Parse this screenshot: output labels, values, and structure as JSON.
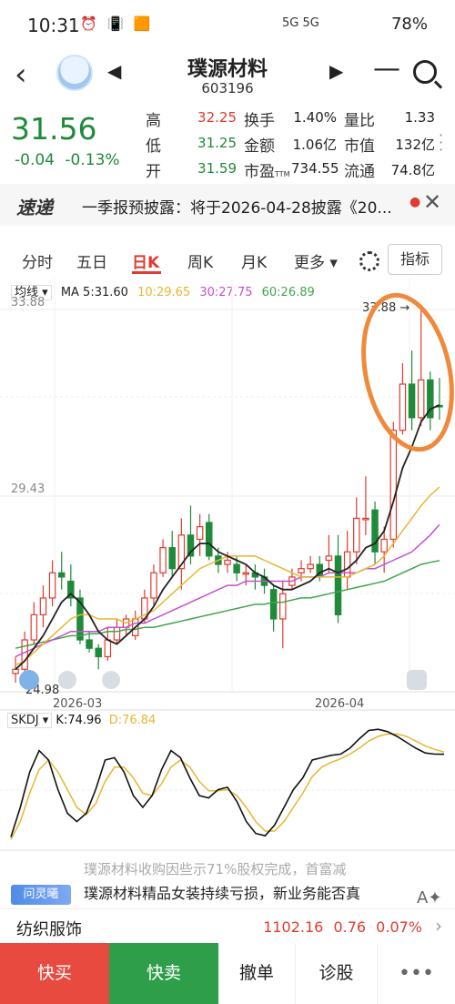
{
  "status_bar": {
    "time": "10:31",
    "icons": "⏰ 📳 🟧",
    "network": "5G 5G",
    "battery": "78%"
  },
  "header": {
    "name": "璞源材料",
    "code": "603196"
  },
  "quote": {
    "price": "31.56",
    "change": "-0.04",
    "change_pct": "-0.13%",
    "high_label": "高",
    "high": "32.25",
    "low_label": "低",
    "low": "31.25",
    "open_label": "开",
    "open": "31.59",
    "turnover_label": "换手",
    "turnover": "1.40%",
    "amount_label": "金额",
    "amount": "1.06亿",
    "pe_label": "市盈",
    "pe_ttm": "TTM",
    "pe": "734.55",
    "vol_ratio_label": "量比",
    "vol_ratio": "1.33",
    "mkt_cap_label": "市值",
    "mkt_cap": "132亿",
    "float_label": "流通",
    "float": "74.8亿"
  },
  "news": {
    "badge": "速递",
    "text": "一季报预披露：将于2026-04-28披露《20..."
  },
  "tabs": [
    "分时",
    "五日",
    "日K",
    "周K",
    "月K",
    "更多 ▾"
  ],
  "indicator_button": "指标",
  "ma_legend": {
    "type": "均线 ▾",
    "ma5": "MA 5:31.60",
    "ma10": "10:29.65",
    "ma20": "30:27.75",
    "ma60": "60:26.89",
    "colors": {
      "ma5": "#222222",
      "ma10": "#e8b632",
      "ma20": "#c64fcf",
      "ma60": "#3fa64a"
    }
  },
  "chart_data": [
    {
      "type": "candlestick",
      "y_labels": [
        "33.88",
        "29.43"
      ],
      "x_labels": [
        "2026-03",
        "2026-04"
      ],
      "annotations": {
        "max_label": "33.88",
        "min_label": "24.98"
      },
      "candles": [
        {
          "o": 25.2,
          "c": 25.3,
          "h": 25.6,
          "l": 24.98
        },
        {
          "o": 25.3,
          "c": 26.0,
          "h": 26.2,
          "l": 25.2
        },
        {
          "o": 26.0,
          "c": 26.6,
          "h": 26.9,
          "l": 25.9
        },
        {
          "o": 26.6,
          "c": 27.0,
          "h": 27.3,
          "l": 26.3
        },
        {
          "o": 27.0,
          "c": 27.6,
          "h": 27.9,
          "l": 26.8
        },
        {
          "o": 27.6,
          "c": 27.5,
          "h": 28.1,
          "l": 27.2
        },
        {
          "o": 27.4,
          "c": 27.0,
          "h": 27.8,
          "l": 26.8
        },
        {
          "o": 27.0,
          "c": 26.0,
          "h": 27.2,
          "l": 25.9
        },
        {
          "o": 26.0,
          "c": 25.8,
          "h": 26.2,
          "l": 25.7
        },
        {
          "o": 25.8,
          "c": 25.6,
          "h": 25.9,
          "l": 25.3
        },
        {
          "o": 25.6,
          "c": 26.0,
          "h": 26.3,
          "l": 25.5
        },
        {
          "o": 26.0,
          "c": 26.3,
          "h": 26.5,
          "l": 25.9
        },
        {
          "o": 26.3,
          "c": 26.5,
          "h": 26.6,
          "l": 26.1
        },
        {
          "o": 26.1,
          "c": 26.5,
          "h": 26.7,
          "l": 26.0
        },
        {
          "o": 26.5,
          "c": 27.0,
          "h": 27.2,
          "l": 26.4
        },
        {
          "o": 27.0,
          "c": 27.6,
          "h": 27.8,
          "l": 26.8
        },
        {
          "o": 27.6,
          "c": 28.2,
          "h": 28.4,
          "l": 27.5
        },
        {
          "o": 28.2,
          "c": 27.7,
          "h": 28.6,
          "l": 27.5
        },
        {
          "o": 27.7,
          "c": 28.5,
          "h": 28.9,
          "l": 27.2
        },
        {
          "o": 28.5,
          "c": 28.0,
          "h": 29.2,
          "l": 27.8
        },
        {
          "o": 28.4,
          "c": 28.7,
          "h": 29.0,
          "l": 28.0
        },
        {
          "o": 28.8,
          "c": 28.0,
          "h": 29.0,
          "l": 27.9
        },
        {
          "o": 28.0,
          "c": 27.8,
          "h": 28.2,
          "l": 27.6
        },
        {
          "o": 27.8,
          "c": 27.9,
          "h": 28.1,
          "l": 27.6
        },
        {
          "o": 27.8,
          "c": 27.6,
          "h": 28.0,
          "l": 27.4
        },
        {
          "o": 27.6,
          "c": 27.6,
          "h": 27.8,
          "l": 27.3
        },
        {
          "o": 27.6,
          "c": 27.5,
          "h": 27.8,
          "l": 27.2
        },
        {
          "o": 27.5,
          "c": 27.3,
          "h": 27.7,
          "l": 27.1
        },
        {
          "o": 27.2,
          "c": 26.5,
          "h": 27.3,
          "l": 26.2
        },
        {
          "o": 26.5,
          "c": 27.1,
          "h": 27.4,
          "l": 25.8
        },
        {
          "o": 27.3,
          "c": 27.5,
          "h": 27.7,
          "l": 27.2
        },
        {
          "o": 27.6,
          "c": 27.7,
          "h": 27.9,
          "l": 27.4
        },
        {
          "o": 27.7,
          "c": 27.8,
          "h": 28.0,
          "l": 27.6
        },
        {
          "o": 27.8,
          "c": 27.5,
          "h": 28.0,
          "l": 27.4
        },
        {
          "o": 27.9,
          "c": 28.0,
          "h": 28.5,
          "l": 27.6
        },
        {
          "o": 28.0,
          "c": 26.6,
          "h": 28.5,
          "l": 26.4
        },
        {
          "o": 27.5,
          "c": 28.1,
          "h": 28.6,
          "l": 27.2
        },
        {
          "o": 28.1,
          "c": 28.9,
          "h": 29.4,
          "l": 27.8
        },
        {
          "o": 28.9,
          "c": 28.9,
          "h": 29.9,
          "l": 28.5
        },
        {
          "o": 29.1,
          "c": 28.1,
          "h": 29.3,
          "l": 27.8
        },
        {
          "o": 28.1,
          "c": 28.4,
          "h": 28.7,
          "l": 27.6
        },
        {
          "o": 28.4,
          "c": 31.0,
          "h": 31.2,
          "l": 28.2
        },
        {
          "o": 31.0,
          "c": 32.1,
          "h": 32.6,
          "l": 30.9
        },
        {
          "o": 32.1,
          "c": 31.3,
          "h": 32.9,
          "l": 31.0
        },
        {
          "o": 31.3,
          "c": 32.2,
          "h": 33.88,
          "l": 31.1
        },
        {
          "o": 32.2,
          "c": 31.3,
          "h": 32.4,
          "l": 31.0
        },
        {
          "o": 31.59,
          "c": 31.56,
          "h": 32.25,
          "l": 31.25
        }
      ],
      "ma5": [
        25.3,
        25.5,
        25.8,
        26.1,
        26.5,
        26.9,
        27.1,
        26.9,
        26.6,
        26.2,
        26.0,
        25.9,
        26.1,
        26.3,
        26.5,
        26.8,
        27.2,
        27.5,
        27.8,
        28.1,
        28.3,
        28.3,
        28.1,
        28.0,
        27.9,
        27.8,
        27.6,
        27.5,
        27.3,
        27.2,
        27.2,
        27.3,
        27.4,
        27.6,
        27.7,
        27.6,
        27.7,
        27.9,
        28.2,
        28.3,
        28.6,
        29.3,
        30.1,
        30.6,
        31.2,
        31.5,
        31.6
      ],
      "ma10": [
        25.4,
        25.5,
        25.7,
        25.9,
        26.1,
        26.3,
        26.5,
        26.6,
        26.6,
        26.5,
        26.5,
        26.5,
        26.4,
        26.5,
        26.6,
        26.7,
        26.9,
        27.1,
        27.3,
        27.5,
        27.7,
        27.8,
        27.9,
        28.0,
        28.0,
        28.0,
        28.0,
        27.9,
        27.8,
        27.7,
        27.6,
        27.5,
        27.5,
        27.5,
        27.5,
        27.5,
        27.5,
        27.6,
        27.7,
        27.8,
        28.0,
        28.3,
        28.6,
        28.9,
        29.2,
        29.45,
        29.65
      ],
      "ma20": [
        25.6,
        25.7,
        25.8,
        25.9,
        26.0,
        26.1,
        26.2,
        26.2,
        26.2,
        26.2,
        26.3,
        26.3,
        26.3,
        26.4,
        26.4,
        26.5,
        26.6,
        26.7,
        26.8,
        26.9,
        27.0,
        27.1,
        27.2,
        27.3,
        27.3,
        27.4,
        27.4,
        27.4,
        27.4,
        27.4,
        27.4,
        27.5,
        27.5,
        27.5,
        27.6,
        27.6,
        27.6,
        27.6,
        27.7,
        27.7,
        27.8,
        27.9,
        28.0,
        28.1,
        28.3,
        28.5,
        28.75
      ],
      "ma60": [
        25.8,
        25.85,
        25.9,
        25.95,
        26.0,
        26.05,
        26.1,
        26.1,
        26.15,
        26.15,
        26.2,
        26.2,
        26.25,
        26.25,
        26.3,
        26.3,
        26.35,
        26.4,
        26.45,
        26.5,
        26.55,
        26.6,
        26.65,
        26.7,
        26.75,
        26.8,
        26.85,
        26.85,
        26.9,
        26.9,
        26.95,
        27.0,
        27.0,
        27.05,
        27.1,
        27.15,
        27.2,
        27.25,
        27.3,
        27.35,
        27.4,
        27.5,
        27.6,
        27.7,
        27.8,
        27.85,
        27.89
      ]
    },
    {
      "type": "line",
      "legend": {
        "name": "SKDJ ▾",
        "k": "K:74.96",
        "d": "D:76.84"
      },
      "colors": {
        "k": "#111111",
        "d": "#e8b632"
      },
      "k": [
        5,
        30,
        60,
        78,
        70,
        45,
        25,
        18,
        25,
        45,
        70,
        72,
        60,
        40,
        30,
        40,
        62,
        78,
        72,
        55,
        40,
        38,
        45,
        47,
        35,
        18,
        8,
        6,
        15,
        30,
        45,
        55,
        70,
        72,
        74,
        75,
        80,
        88,
        95,
        96,
        94,
        90,
        85,
        80,
        76,
        75,
        74.96
      ],
      "d": [
        3,
        18,
        42,
        62,
        70,
        60,
        45,
        30,
        24,
        33,
        52,
        64,
        64,
        55,
        42,
        40,
        50,
        64,
        70,
        64,
        52,
        44,
        44,
        45,
        40,
        30,
        18,
        10,
        10,
        18,
        30,
        42,
        56,
        64,
        68,
        71,
        75,
        80,
        86,
        90,
        92,
        92,
        90,
        86,
        82,
        79,
        76.84
      ]
    }
  ],
  "promo": {
    "badge": "问灵曦",
    "faded_text": "璞源材料收购因些示71%股权完成，首富减",
    "text": "璞源材料精品女装持续亏损，新业务能否真"
  },
  "sector": {
    "name": "纺织服饰",
    "value": "1102.16",
    "change": "0.76",
    "change_pct": "0.07%"
  },
  "actions": {
    "buy": "快买",
    "sell": "快卖",
    "cancel": "撤单",
    "diagnose": "诊股",
    "more": "•••"
  }
}
